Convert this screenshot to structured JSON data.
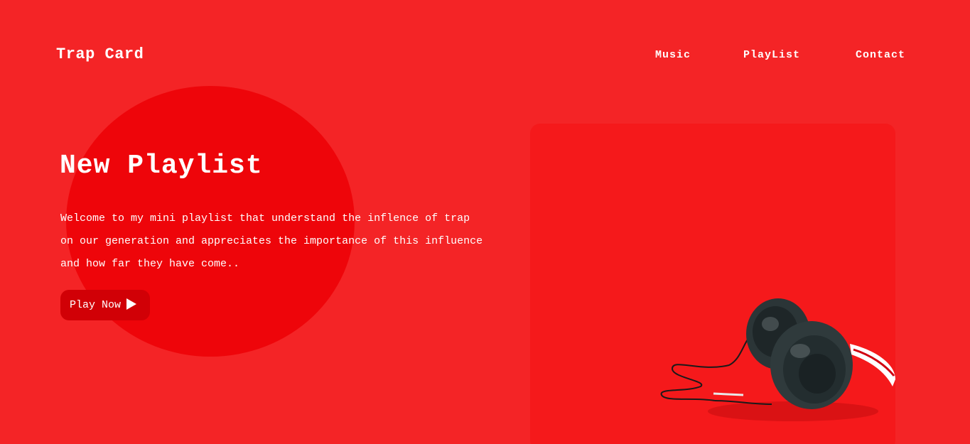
{
  "header": {
    "brand": "Trap Card",
    "nav": [
      {
        "label": "Music"
      },
      {
        "label": "PlayList"
      },
      {
        "label": "Contact"
      }
    ]
  },
  "hero": {
    "title": "New Playlist",
    "description": "Welcome to my mini playlist that understand the inflence of trap on our generation and appreciates the importance of this influence and how far they have come..",
    "play_label": "Play Now",
    "play_icon": "play-icon"
  },
  "colors": {
    "background": "#f42426",
    "circle": "#ee050a",
    "button": "#d10006",
    "card": "#f5191b"
  }
}
